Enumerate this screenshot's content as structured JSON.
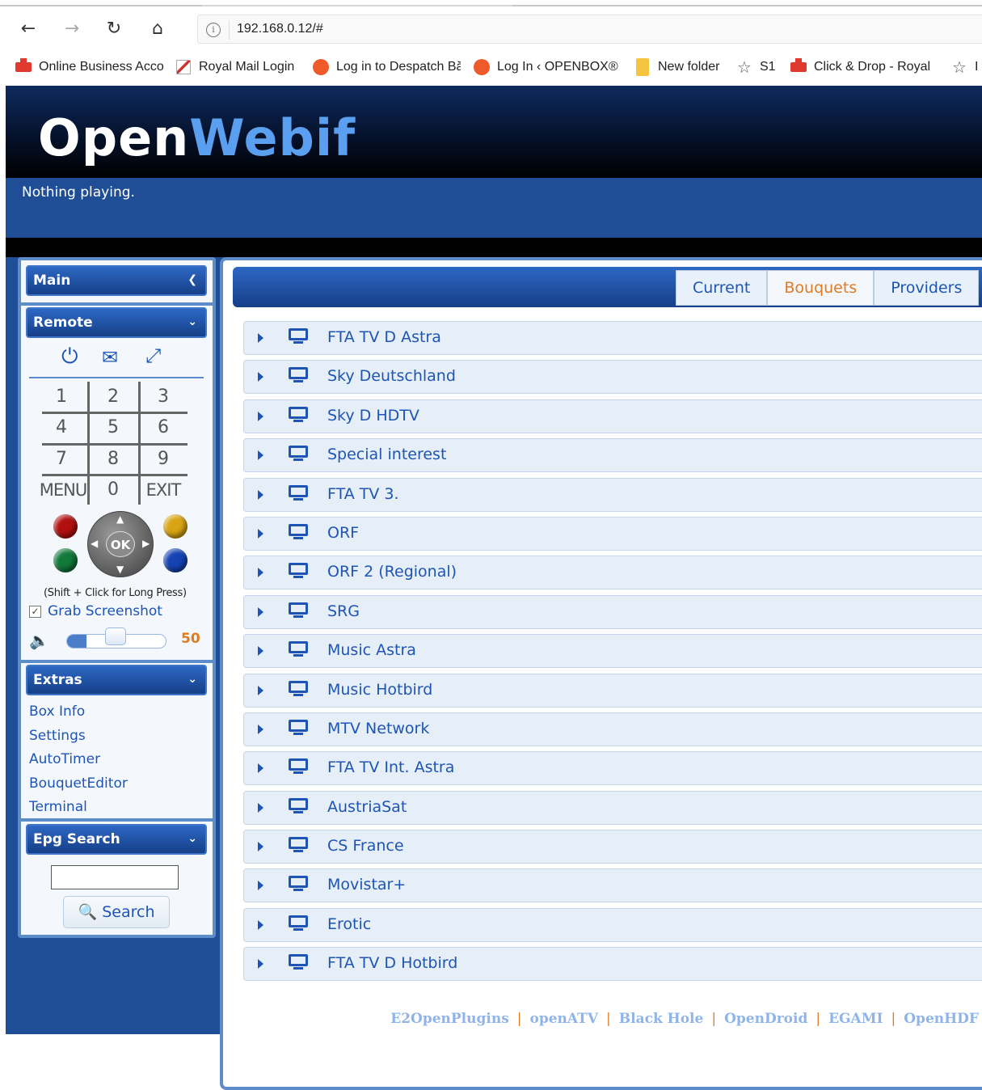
{
  "browser": {
    "url": "192.168.0.12/#",
    "bookmarks": [
      {
        "label": "Online Business Acco",
        "icon": "red-mail-icon"
      },
      {
        "label": "Royal Mail  Login",
        "icon": "royal-mail-icon"
      },
      {
        "label": "Log in to Despatch Bă",
        "icon": "despatch-icon"
      },
      {
        "label": "Log In ‹ OPENBOX®",
        "icon": "openbox-icon"
      },
      {
        "label": "New folder",
        "icon": "folder-icon"
      },
      {
        "label": "S1",
        "icon": "star-icon"
      },
      {
        "label": "Click & Drop - Royal",
        "icon": "red-mail-icon"
      },
      {
        "label": "I",
        "icon": "star-icon"
      }
    ]
  },
  "header": {
    "logo_open": "Open",
    "logo_webif": "Webif",
    "now_playing": "Nothing playing."
  },
  "sidebar": {
    "main_label": "Main",
    "remote_label": "Remote",
    "keypad": [
      "1",
      "2",
      "3",
      "4",
      "5",
      "6",
      "7",
      "8",
      "9",
      "MENU",
      "0",
      "EXIT"
    ],
    "ok_label": "OK",
    "long_press_hint": "(Shift + Click for Long Press)",
    "grab_screenshot": "Grab Screenshot",
    "grab_checked": true,
    "volume": 50,
    "volume_label": "50",
    "extras_label": "Extras",
    "extras_links": [
      "Box Info",
      "Settings",
      "AutoTimer",
      "BouquetEditor",
      "Terminal"
    ],
    "epg_label": "Epg Search",
    "epg_value": "",
    "search_label": "Search"
  },
  "main": {
    "tabs": [
      {
        "label": "Current",
        "active": false
      },
      {
        "label": "Bouquets",
        "active": true
      },
      {
        "label": "Providers",
        "active": false
      }
    ],
    "bouquets": [
      "FTA TV D Astra",
      "Sky Deutschland",
      "Sky D HDTV",
      "Special interest",
      "FTA TV 3.",
      "ORF",
      "ORF 2 (Regional)",
      "SRG",
      "Music Astra",
      "Music Hotbird",
      "MTV Network",
      "FTA TV Int. Astra",
      "AustriaSat",
      "CS France",
      "Movistar+",
      "Erotic",
      "FTA TV D Hotbird"
    ]
  },
  "footer": {
    "links": [
      "E2OpenPlugins",
      "openATV",
      "Black Hole",
      "OpenDroid",
      "EGAMI",
      "OpenHDF"
    ]
  },
  "colors": {
    "accent": "#1e55b4",
    "active_tab": "#e07b1f",
    "brand_dark": "#1f4e96",
    "logo_blue": "#5b9ff0"
  }
}
